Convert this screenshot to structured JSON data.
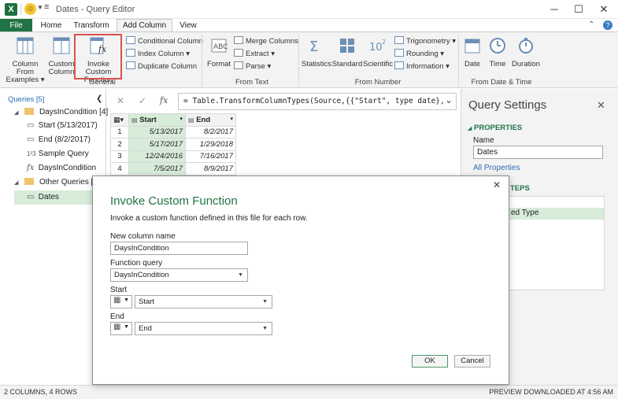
{
  "window": {
    "title": "Dates - Query Editor",
    "minimize": "─",
    "maximize": "☐",
    "close": "✕",
    "collapse_ribbon": "⌃",
    "help": "?"
  },
  "menu": {
    "file": "File",
    "home": "Home",
    "transform": "Transform",
    "add_column": "Add Column",
    "view": "View"
  },
  "ribbon": {
    "column_from_examples": [
      "Column From",
      "Examples ▾"
    ],
    "custom_column": [
      "Custom",
      "Column"
    ],
    "invoke_custom_function": [
      "Invoke Custom",
      "Function"
    ],
    "conditional_column": "Conditional Column",
    "index_column": "Index Column ▾",
    "duplicate_column": "Duplicate Column",
    "group_general": "General",
    "format": "Format",
    "merge_columns": "Merge Columns",
    "extract": "Extract ▾",
    "parse": "Parse ▾",
    "group_from_text": "From Text",
    "statistics": "Statistics",
    "standard": "Standard",
    "scientific": "Scientific",
    "trigonometry": "Trigonometry ▾",
    "rounding": "Rounding ▾",
    "information": "Information ▾",
    "group_from_number": "From Number",
    "date": "Date",
    "time": "Time",
    "duration": "Duration",
    "group_from_date_time": "From Date & Time"
  },
  "queries": {
    "header": "Queries [5]",
    "collapse": "❮",
    "group1": "DaysInCondition [4]",
    "items1": [
      "Start (5/13/2017)",
      "End (8/2/2017)",
      "Sample Query",
      "DaysInCondition"
    ],
    "item_icons": [
      "▭",
      "▭",
      "1²3",
      "fx"
    ],
    "group2": "Other Queries [1]",
    "items2": [
      "Dates"
    ]
  },
  "formula": {
    "cancel": "✕",
    "commit": "✓",
    "fx": "fx",
    "text": "= Table.TransformColumnTypes(Source,{{\"Start\", type date},",
    "expand": "⌄"
  },
  "grid": {
    "columns": [
      "Start",
      "End"
    ],
    "rows": [
      [
        "1",
        "5/13/2017",
        "8/2/2017"
      ],
      [
        "2",
        "5/17/2017",
        "1/29/2018"
      ],
      [
        "3",
        "12/24/2016",
        "7/16/2017"
      ],
      [
        "4",
        "7/5/2017",
        "8/9/2017"
      ]
    ]
  },
  "settings": {
    "title": "Query Settings",
    "close": "✕",
    "properties": "PROPERTIES",
    "name_label": "Name",
    "name_value": "Dates",
    "all_properties": "All Properties",
    "applied_steps_partial": "TEPS",
    "step_partial": "ed Type"
  },
  "status": {
    "left": "2 COLUMNS, 4 ROWS",
    "right": "PREVIEW DOWNLOADED AT 4:56 AM"
  },
  "dialog": {
    "title": "Invoke Custom Function",
    "subtitle": "Invoke a custom function defined in this file for each row.",
    "close": "✕",
    "new_column_label": "New column name",
    "new_column_value": "DaysInCondition",
    "function_query_label": "Function query",
    "function_query_value": "DaysInCondition",
    "start_label": "Start",
    "start_value": "Start",
    "end_label": "End",
    "end_value": "End",
    "ok": "OK",
    "cancel": "Cancel"
  },
  "colors": {
    "accent": "#217346",
    "highlight": "#d9534f",
    "cell_fill": "#d7ecd9"
  }
}
